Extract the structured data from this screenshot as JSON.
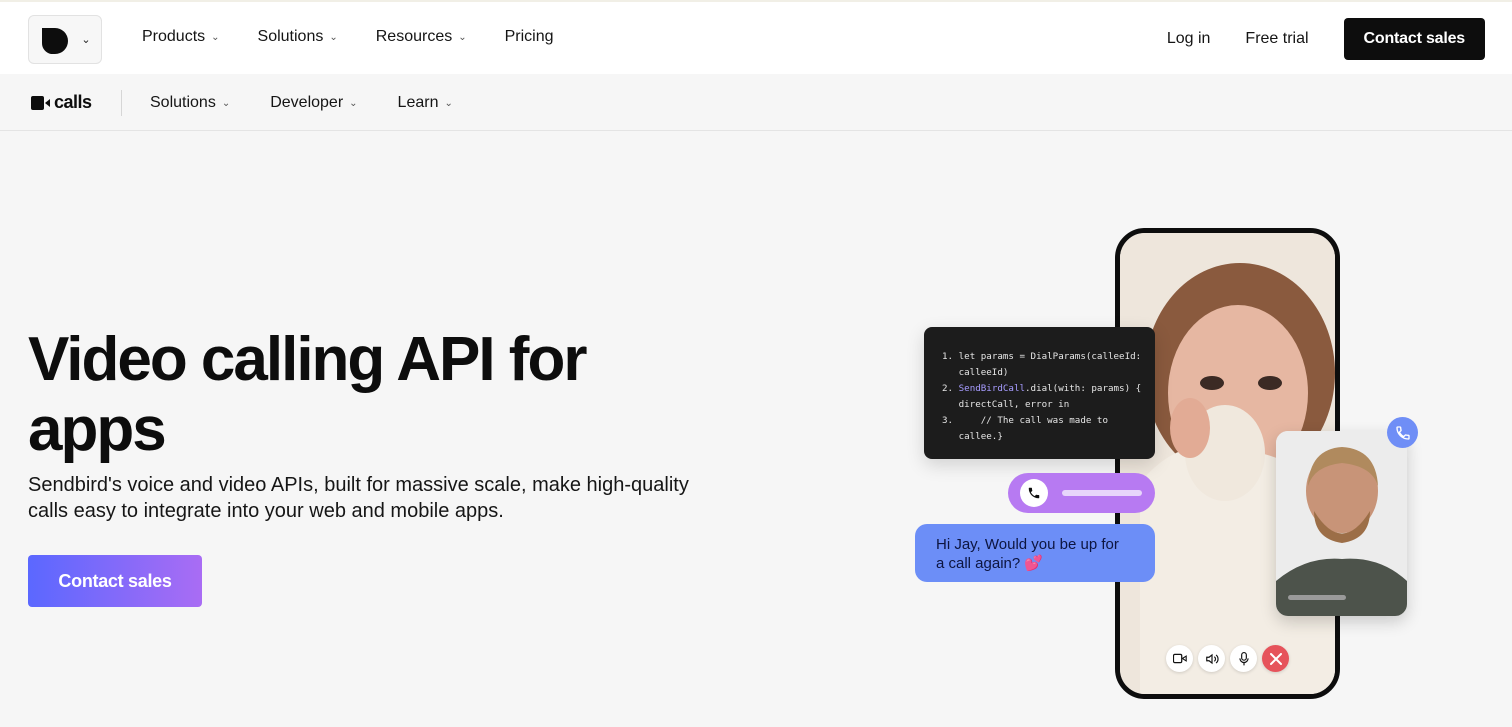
{
  "topnav": {
    "logo_icon": "sendbird-logo-icon",
    "items": [
      {
        "label": "Products"
      },
      {
        "label": "Solutions"
      },
      {
        "label": "Resources"
      },
      {
        "label": "Pricing"
      }
    ],
    "login_label": "Log in",
    "free_trial_label": "Free trial",
    "contact_label": "Contact sales"
  },
  "subnav": {
    "product_name": "calls",
    "items": [
      {
        "label": "Solutions"
      },
      {
        "label": "Developer"
      },
      {
        "label": "Learn"
      }
    ]
  },
  "hero": {
    "title_line1": "Video calling API for",
    "title_line2": "apps",
    "subtitle_line1": "Sendbird's voice and video APIs, built for massive scale, make high-quality",
    "subtitle_line2": "calls easy to integrate into your web and mobile apps.",
    "cta_label": "Contact sales"
  },
  "illustration": {
    "code_lines": [
      {
        "num": "1.",
        "text": "let params = DialParams(calleeId:"
      },
      {
        "num": "",
        "text": "calleeId)"
      },
      {
        "num": "2.",
        "kw": "SendBirdCall",
        "text": ".dial(with: params) {"
      },
      {
        "num": "",
        "text": "directCall, error in"
      },
      {
        "num": "3.",
        "text": "    // The call was made to"
      },
      {
        "num": "",
        "text": "callee.}"
      }
    ],
    "message_line1": "Hi Jay, Would you be up for",
    "message_line2": "a call again? 💕",
    "controls": [
      "video-icon",
      "speaker-icon",
      "microphone-icon",
      "end-call-icon"
    ]
  },
  "colors": {
    "brand_dark": "#0d0d0d",
    "gradient_start": "#5b68ff",
    "gradient_end": "#a96cf4",
    "bubble_blue": "#6c8ef7",
    "pill_purple": "#b77af2",
    "end_call_red": "#e6535b"
  }
}
